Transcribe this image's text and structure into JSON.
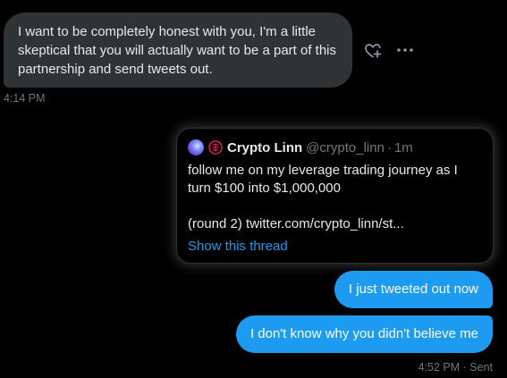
{
  "incoming_message": {
    "text": "I want to be completely honest with you, I'm a little skeptical  that you will actually want to be a part of this partnership and send tweets out.",
    "time": "4:14 PM"
  },
  "actions": {
    "react_icon": "heart-plus-icon",
    "more_icon": "more-horizontal-icon"
  },
  "quoted_tweet": {
    "avatar_icon": "crypto-avatar",
    "badge_icon": "red-seal-badge-icon",
    "name": "Crypto Linn",
    "handle": "@crypto_linn",
    "separator": "·",
    "time": "1m",
    "body": "follow me on my leverage trading journey as I turn $100 into $1,000,000\n\n(round 2) twitter.com/crypto_linn/st...",
    "show_thread": "Show this thread"
  },
  "outgoing_messages": [
    {
      "text": "I just tweeted out now"
    },
    {
      "text": "I don't know why you didn't believe me"
    }
  ],
  "outgoing_meta": "4:52 PM · Sent",
  "colors": {
    "background": "#000000",
    "incoming_bubble": "#2f3336",
    "outgoing_bubble": "#1d9bf0",
    "link": "#1d9bf0",
    "muted_text": "#71767b"
  }
}
